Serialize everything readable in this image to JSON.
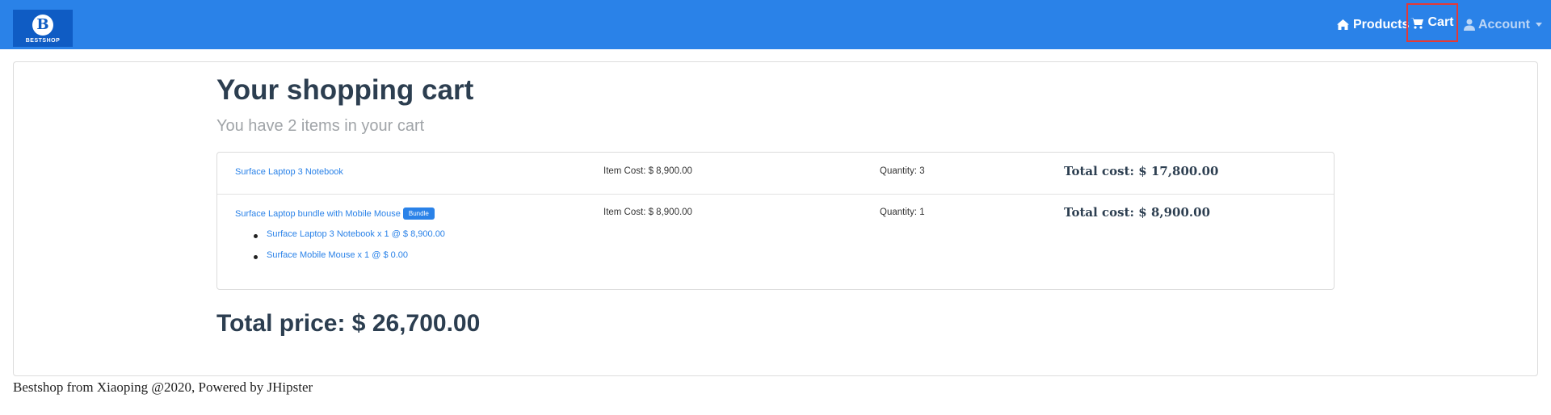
{
  "navbar": {
    "brand": {
      "letter": "B",
      "text": "BESTSHOP"
    },
    "products_label": "Products",
    "cart_label": "Cart",
    "account_label": "Account",
    "colors": {
      "navbar_bg": "#2a82e8",
      "highlight_border": "#e53935"
    }
  },
  "cart": {
    "title": "Your shopping cart",
    "subtitle": "You have 2 items in your cart",
    "items": [
      {
        "name": "Surface Laptop 3 Notebook",
        "item_cost": "Item Cost: $ 8,900.00",
        "quantity": "Quantity: 3",
        "total": "Total cost: $ 17,800.00"
      },
      {
        "name": "Surface Laptop bundle with Mobile Mouse",
        "badge": "Bundle",
        "item_cost": "Item Cost: $ 8,900.00",
        "quantity": "Quantity: 1",
        "total": "Total cost: $ 8,900.00",
        "subitems": [
          "Surface Laptop 3 Notebook x 1 @ $ 8,900.00",
          "Surface Mobile Mouse x 1 @ $ 0.00"
        ]
      }
    ],
    "total_price": "Total price: $ 26,700.00"
  },
  "footer": {
    "text": "Bestshop from Xiaoping @2020, Powered by JHipster"
  },
  "icons": {
    "products": "home-icon",
    "cart": "cart-icon",
    "account": "user-icon"
  }
}
